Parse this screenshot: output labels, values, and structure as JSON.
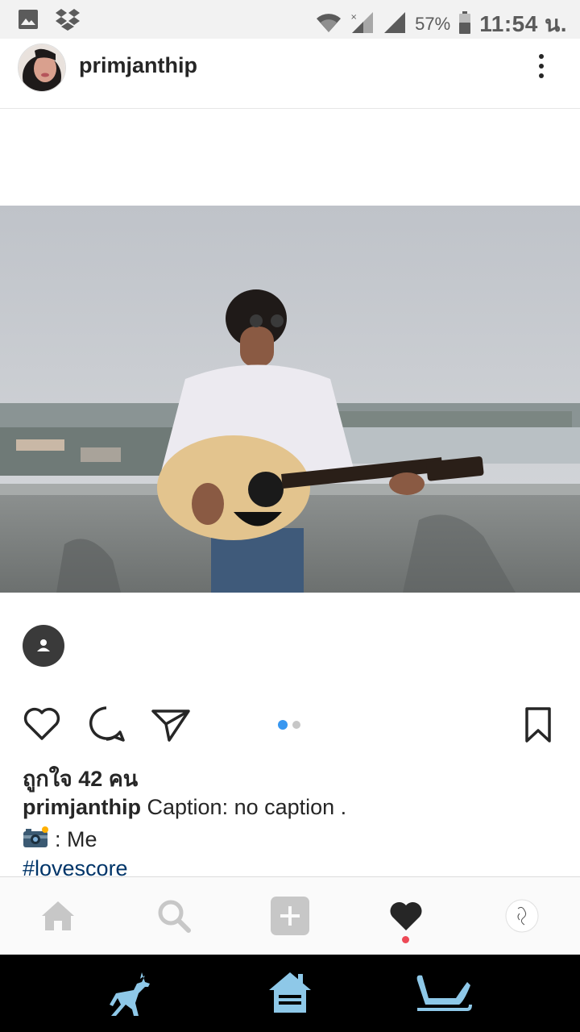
{
  "status_bar": {
    "battery_percent": "57%",
    "time": "11:54 น."
  },
  "post": {
    "username": "primjanthip",
    "likes_text": "ถูกใจ 42 คน",
    "caption_user": "primjanthip",
    "caption_text": " Caption: no caption .",
    "credit_text": ": Me",
    "hashtag": "#lovescore",
    "carousel": {
      "total": 2,
      "current": 1
    }
  },
  "icons": {
    "status_left": [
      "image-icon",
      "dropbox-icon"
    ],
    "status_right": [
      "wifi-icon",
      "signal-icon",
      "battery-icon"
    ],
    "actions": [
      "heart-icon",
      "comment-icon",
      "share-icon",
      "bookmark-icon"
    ],
    "bottom_nav": [
      "home-icon",
      "search-icon",
      "add-icon",
      "activity-icon",
      "profile-icon"
    ],
    "android_nav": [
      "deer-icon",
      "house-icon",
      "sleigh-icon"
    ]
  },
  "colors": {
    "link": "#003569",
    "carousel_active": "#3897f0",
    "notification": "#ed4956",
    "android_icons": "#8ec8e8"
  }
}
